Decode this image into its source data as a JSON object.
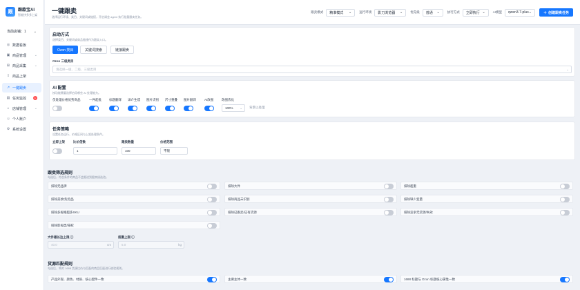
{
  "brand": {
    "name": "跟款宝AI",
    "subtitle": "智能拼多多上架",
    "logo": "跟"
  },
  "store": {
    "label": "当前店铺：1",
    "caret": "chevron-down-icon"
  },
  "nav": [
    {
      "label": "数据看板",
      "icon": "dashboard-icon",
      "glyph": "◎"
    },
    {
      "label": "商品管理",
      "icon": "box-icon",
      "glyph": "▣",
      "caret": "⌄"
    },
    {
      "label": "商品采集",
      "icon": "collect-icon",
      "glyph": "⊞",
      "caret": "⌄"
    },
    {
      "label": "商品上架",
      "icon": "upload-icon",
      "glyph": "⇪"
    },
    {
      "label": "一键跟卖",
      "icon": "follow-icon",
      "glyph": "↗",
      "active": true
    },
    {
      "label": "任务监控",
      "icon": "monitor-icon",
      "glyph": "▤",
      "badge": "1"
    },
    {
      "label": "店铺管理",
      "icon": "store-icon",
      "glyph": "⌂",
      "caret": "⌄"
    },
    {
      "label": "个人账户",
      "icon": "user-icon",
      "glyph": "☺"
    },
    {
      "label": "系统设置",
      "icon": "gear-icon",
      "glyph": "⚙"
    }
  ],
  "header": {
    "title": "一键跟卖",
    "desc": "选择运行环境、类目、关键词或链接，开启调会 agent 执行批量跟卖任务。",
    "controls": [
      {
        "label": "跟卖模式",
        "value": "精准模式"
      },
      {
        "label": "运行环境",
        "value": "影刀浏览器"
      },
      {
        "label": "优先级",
        "value": "普通"
      },
      {
        "label": "执行方式",
        "value": "立即执行"
      },
      {
        "label": "AI模型",
        "value": "qwen3.7-plus"
      }
    ],
    "create_button": "创建跟卖任务"
  },
  "start": {
    "title": "启动方式",
    "desc": "选择类目、关键词或商品链接作为跟卖入口。",
    "modes": [
      "Ozon 类目",
      "关键词搜索",
      "链接跟卖"
    ],
    "category_label": "Ozon 三级类目",
    "category_placeholder": "请选择一级、二级、三级类目"
  },
  "ai": {
    "title": "AI 配置",
    "desc": "按功能需要选择启用哪些 AI 处理能力。",
    "toggles": [
      {
        "label": "仅处理价格优势商品",
        "on": false
      },
      {
        "label": "一件起批",
        "on": true
      },
      {
        "label": "标题翻译",
        "on": true
      },
      {
        "label": "详介生成",
        "on": true
      },
      {
        "label": "图片识别",
        "on": true
      },
      {
        "label": "尺寸重叠",
        "on": true
      },
      {
        "label": "图片翻译",
        "on": true
      },
      {
        "label": "AI改图",
        "on": true
      },
      {
        "label": "改图去化",
        "value": "100%",
        "extra": "背景以处理"
      }
    ]
  },
  "strategy": {
    "title": "任务策略",
    "desc": "设置任务运行、价格区间与上架处理条件。",
    "fields": [
      {
        "label": "立即上架",
        "toggle": false
      },
      {
        "label": "比价倍数",
        "value": "1"
      },
      {
        "label": "跟卖数量",
        "value": "100"
      },
      {
        "label": "价格范围",
        "value": "不限"
      }
    ]
  },
  "filter": {
    "title": "跟卖筛选规则",
    "desc": "勾选后，符合条件的商品不会跟进到跟卖候选池。",
    "rules": [
      {
        "label": "排除无品牌",
        "on": false
      },
      {
        "label": "排除大件",
        "on": false
      },
      {
        "label": "排除超重",
        "on": false
      },
      {
        "label": "排除美妆/危险品",
        "on": false
      },
      {
        "label": "排除商品未识别",
        "on": false
      },
      {
        "label": "排除缺少变量",
        "on": false
      },
      {
        "label": "排除多规格超多SKU",
        "on": false
      },
      {
        "label": "排除已跟卖/已有货源",
        "on": false
      },
      {
        "label": "排除竞争无货源/失效",
        "on": false
      },
      {
        "label": "排除影视类/侵权",
        "on": false
      }
    ],
    "size_label": "大件最长边上限",
    "size_placeholder": "40.0",
    "size_unit": "cm",
    "weight_label": "超重上限",
    "weight_placeholder": "5.0",
    "weight_unit": "kg",
    "info_icon": "ⓘ"
  },
  "match": {
    "title": "货源匹配规则",
    "desc": "勾选后，将对 1688 货源比价与匹配的商品匹配进行校验规则。",
    "rules": [
      {
        "label": "产品外观、颜色、材质、核心配件一致",
        "on": true
      },
      {
        "label": "主要主体一致",
        "on": true
      },
      {
        "label": "1688 标题与 Ozon 标题核心属性一致",
        "on": true
      }
    ]
  }
}
